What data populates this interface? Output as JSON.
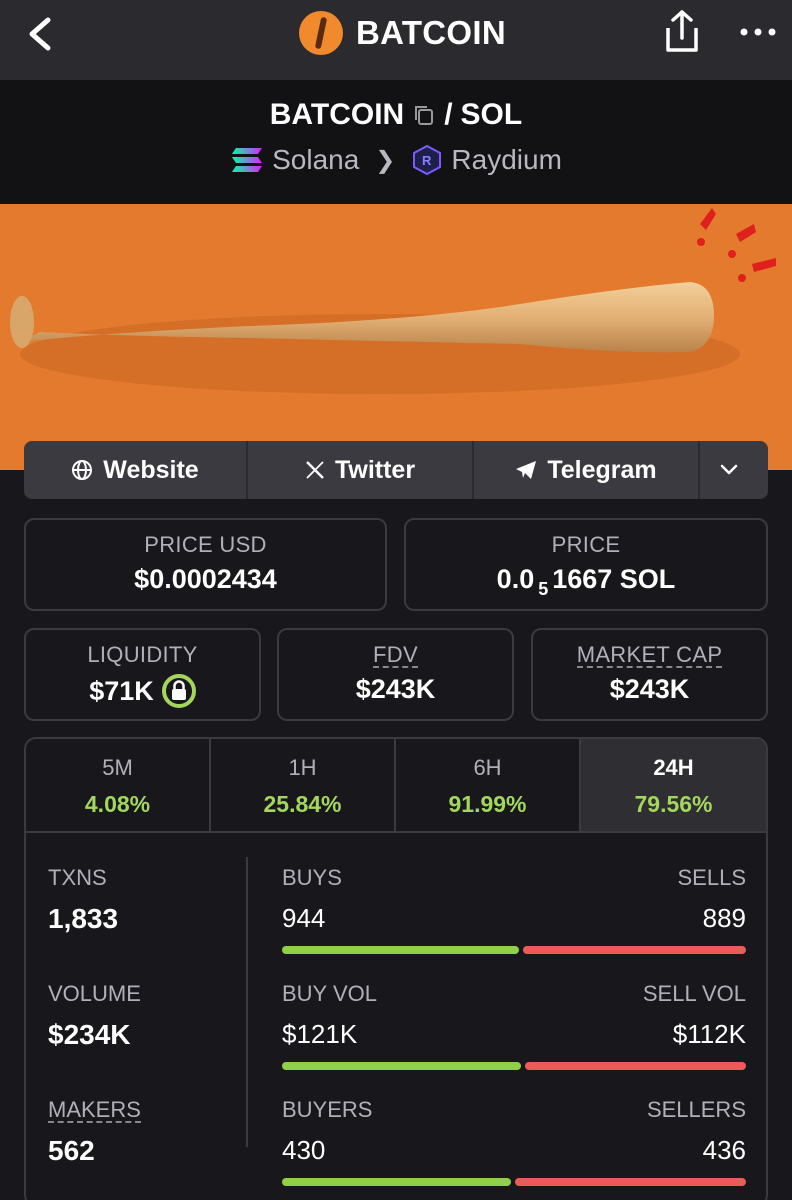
{
  "header": {
    "title": "BATCOIN",
    "icons": [
      "back-arrow-icon",
      "batcoin-logo",
      "share-icon",
      "more-icon"
    ]
  },
  "pair": {
    "base": "BATCOIN",
    "separator": "/",
    "quote": "SOL",
    "chain": "Solana",
    "dex": "Raydium"
  },
  "links": {
    "website": "Website",
    "twitter": "Twitter",
    "telegram": "Telegram"
  },
  "prices": {
    "usd_label": "PRICE USD",
    "usd_value": "$0.0002434",
    "native_label": "PRICE",
    "native_prefix": "0.0",
    "native_sub": "5",
    "native_rest": "1667 SOL"
  },
  "metrics": {
    "liquidity_label": "LIQUIDITY",
    "liquidity_value": "$71K",
    "fdv_label": "FDV",
    "fdv_value": "$243K",
    "mcap_label": "MARKET CAP",
    "mcap_value": "$243K"
  },
  "tabs": [
    {
      "label": "5M",
      "value": "4.08%"
    },
    {
      "label": "1H",
      "value": "25.84%"
    },
    {
      "label": "6H",
      "value": "91.99%"
    },
    {
      "label": "24H",
      "value": "79.56%"
    }
  ],
  "stats": {
    "txns": {
      "label": "TXNS",
      "value": "1,833",
      "left_label": "BUYS",
      "left_value": "944",
      "right_label": "SELLS",
      "right_value": "889",
      "buy_fraction": 0.515
    },
    "volume": {
      "label": "VOLUME",
      "value": "$234K",
      "left_label": "BUY VOL",
      "left_value": "$121K",
      "right_label": "SELL VOL",
      "right_value": "$112K",
      "buy_fraction": 0.52
    },
    "makers": {
      "label": "MAKERS",
      "value": "562",
      "left_label": "BUYERS",
      "left_value": "430",
      "right_label": "SELLERS",
      "right_value": "436",
      "buy_fraction": 0.497
    }
  },
  "colors": {
    "positive": "#a3d65c",
    "buy_bar": "#8fcf4a",
    "sell_bar": "#ee5a5a",
    "brand_orange": "#e37a2e"
  }
}
